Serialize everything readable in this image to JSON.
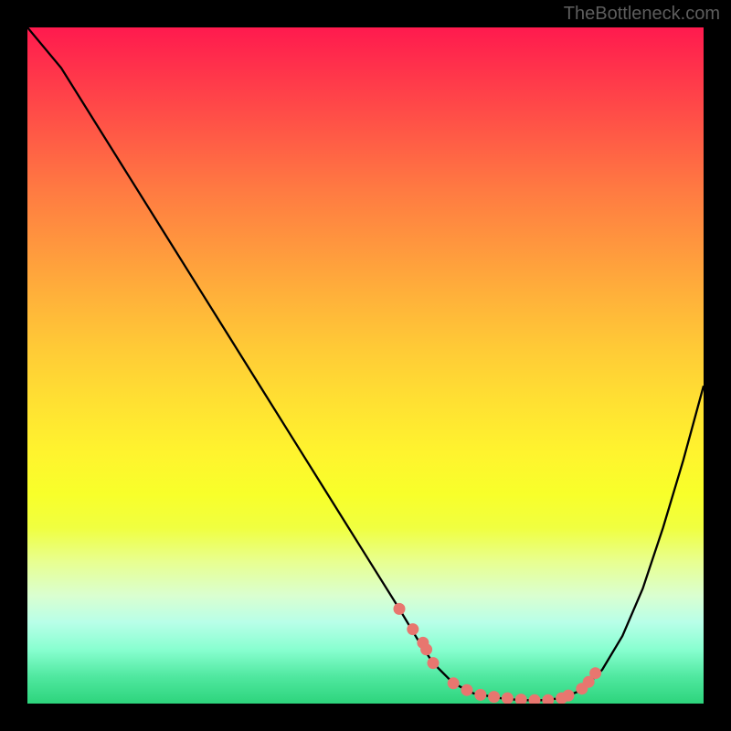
{
  "watermark": "TheBottleneck.com",
  "chart_data": {
    "type": "line",
    "title": "",
    "xlabel": "",
    "ylabel": "",
    "xlim": [
      0,
      100
    ],
    "ylim": [
      0,
      100
    ],
    "curve": {
      "series_name": "bottleneck-curve",
      "x": [
        0,
        5,
        10,
        15,
        20,
        25,
        30,
        35,
        40,
        45,
        50,
        55,
        58,
        60,
        63,
        66,
        70,
        73,
        76,
        79,
        82,
        85,
        88,
        91,
        94,
        97,
        100
      ],
      "y": [
        100,
        94,
        86,
        78,
        70,
        62,
        54,
        46,
        38,
        30,
        22,
        14,
        9,
        6,
        3,
        1.5,
        0.8,
        0.5,
        0.5,
        0.8,
        2,
        5,
        10,
        17,
        26,
        36,
        47
      ]
    },
    "scatter_points": {
      "series_name": "highlighted-points",
      "x": [
        55,
        57,
        58.5,
        59,
        60,
        63,
        65,
        67,
        69,
        71,
        73,
        75,
        77,
        79,
        80,
        82,
        83,
        84
      ],
      "y": [
        14,
        11,
        9,
        8,
        6,
        3,
        2,
        1.3,
        1,
        0.8,
        0.6,
        0.5,
        0.5,
        0.8,
        1.2,
        2.2,
        3.2,
        4.5
      ]
    },
    "colors": {
      "curve_stroke": "#000000",
      "point_fill": "#e8766f",
      "gradient_top": "#ff1a4e",
      "gradient_bottom": "#2dd47c"
    }
  }
}
